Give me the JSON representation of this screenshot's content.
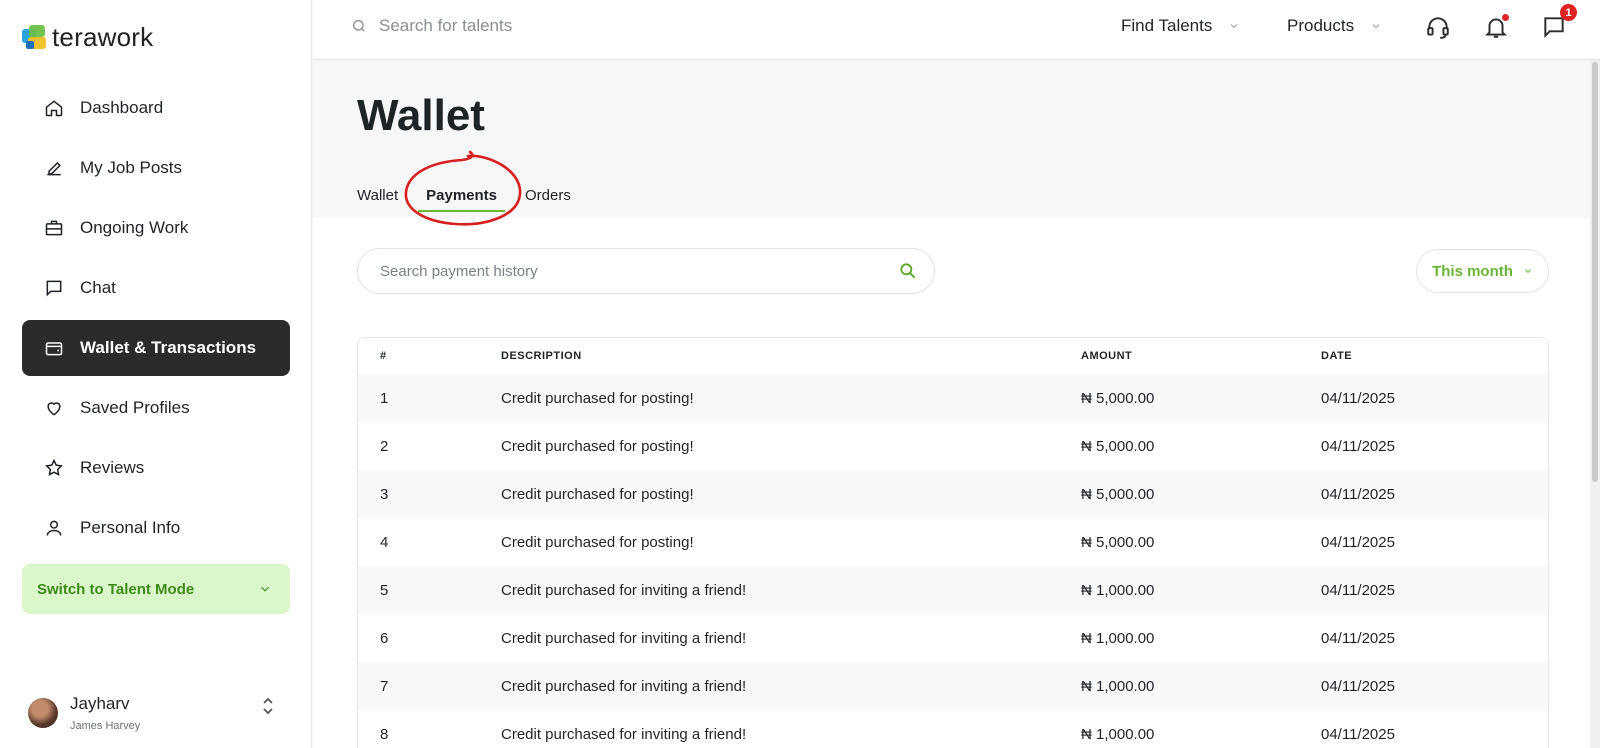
{
  "brand": {
    "name": "terawork"
  },
  "sidebar": {
    "items": [
      {
        "label": "Dashboard",
        "icon": "home-icon",
        "active": false
      },
      {
        "label": "My Job Posts",
        "icon": "pencil-icon",
        "active": false
      },
      {
        "label": "Ongoing Work",
        "icon": "briefcase-icon",
        "active": false
      },
      {
        "label": "Chat",
        "icon": "chat-icon",
        "active": false
      },
      {
        "label": "Wallet & Transactions",
        "icon": "wallet-icon",
        "active": true
      },
      {
        "label": "Saved Profiles",
        "icon": "heart-icon",
        "active": false
      },
      {
        "label": "Reviews",
        "icon": "star-icon",
        "active": false
      },
      {
        "label": "Personal Info",
        "icon": "user-icon",
        "active": false
      }
    ],
    "switch_label": "Switch to Talent Mode",
    "user": {
      "name": "Jayharv",
      "fullname": "James Harvey"
    }
  },
  "topbar": {
    "search_placeholder": "Search for talents",
    "menu_find": "Find Talents",
    "menu_products": "Products",
    "messages_badge": "1"
  },
  "main": {
    "title": "Wallet",
    "tabs": [
      {
        "label": "Wallet",
        "active": false
      },
      {
        "label": "Payments",
        "active": true
      },
      {
        "label": "Orders",
        "active": false
      }
    ],
    "search_placeholder": "Search payment history",
    "filter_label": "This month",
    "table": {
      "headers": [
        "#",
        "DESCRIPTION",
        "AMOUNT",
        "DATE"
      ],
      "rows": [
        [
          "1",
          "Credit purchased for posting!",
          "₦ 5,000.00",
          "04/11/2025"
        ],
        [
          "2",
          "Credit purchased for posting!",
          "₦ 5,000.00",
          "04/11/2025"
        ],
        [
          "3",
          "Credit purchased for posting!",
          "₦ 5,000.00",
          "04/11/2025"
        ],
        [
          "4",
          "Credit purchased for posting!",
          "₦ 5,000.00",
          "04/11/2025"
        ],
        [
          "5",
          "Credit purchased for inviting a friend!",
          "₦ 1,000.00",
          "04/11/2025"
        ],
        [
          "6",
          "Credit purchased for inviting a friend!",
          "₦ 1,000.00",
          "04/11/2025"
        ],
        [
          "7",
          "Credit purchased for inviting a friend!",
          "₦ 1,000.00",
          "04/11/2025"
        ],
        [
          "8",
          "Credit purchased for inviting a friend!",
          "₦ 1,000.00",
          "04/11/2025"
        ]
      ]
    }
  },
  "colors": {
    "accent_green": "#6ab534",
    "active_nav_bg": "#2b2b2b",
    "switch_bg": "#daf7c9",
    "badge_red": "#e02424",
    "annotation_red": "#d81f1f"
  }
}
